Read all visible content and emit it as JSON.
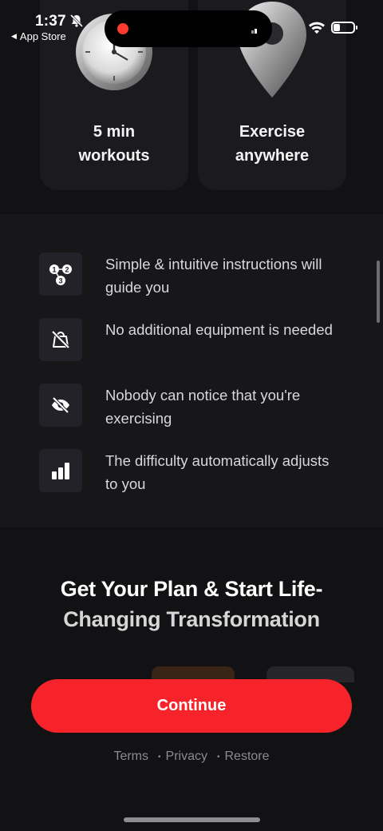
{
  "status_bar": {
    "time": "1:37",
    "back_app_label": "App Store"
  },
  "feature_cards": [
    {
      "label_line1": "5 min",
      "label_line2": "workouts",
      "icon": "stopwatch-icon"
    },
    {
      "label_line1": "Exercise",
      "label_line2": "anywhere",
      "icon": "location-pin-icon"
    }
  ],
  "benefits": [
    {
      "text": "Simple & intuitive instructions will guide you",
      "icon": "steps-icon"
    },
    {
      "text": "No additional equipment is needed",
      "icon": "no-weight-icon"
    },
    {
      "text": "Nobody can notice that you're exercising",
      "icon": "eye-off-icon"
    },
    {
      "text": "The difficulty automatically adjusts to you",
      "icon": "bar-chart-icon"
    }
  ],
  "headline": {
    "line1": "Get Your Plan & Start Life-",
    "line2": "Changing Transformation"
  },
  "continue_label": "Continue",
  "footer": {
    "terms": "Terms",
    "privacy": "Privacy",
    "restore": "Restore",
    "separator": "•"
  },
  "colors": {
    "accent": "#f6242a",
    "background": "#121215",
    "card": "#1b1b1f",
    "text_secondary": "#d8d8dc",
    "footer_text": "#8a8a92"
  }
}
